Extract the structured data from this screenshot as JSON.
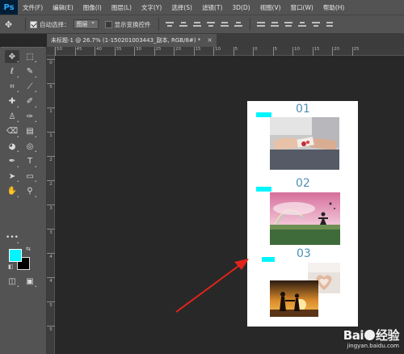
{
  "menubar": {
    "logo": "Ps",
    "items": [
      "文件(F)",
      "编辑(E)",
      "图像(I)",
      "图层(L)",
      "文字(Y)",
      "选择(S)",
      "滤镜(T)",
      "3D(D)",
      "视图(V)",
      "窗口(W)",
      "帮助(H)"
    ]
  },
  "options": {
    "auto_select_label": "自动选择：",
    "auto_select_checked": true,
    "auto_select_value": "图层",
    "show_transform_label": "显示变换控件",
    "show_transform_checked": false
  },
  "document_tab": {
    "title": "未标题-1 @ 26.7% (1-150201003443_副本, RGB/8#) *",
    "close": "×"
  },
  "ruler": {
    "h_labels": [
      "50",
      "45",
      "40",
      "35",
      "30",
      "25",
      "20",
      "15",
      "10",
      "5",
      "0",
      "5",
      "10",
      "15",
      "20",
      "25"
    ],
    "v_labels": [
      "0",
      "5",
      "1",
      "1",
      "2",
      "2",
      "3",
      "3",
      "4",
      "4",
      "5",
      "5"
    ]
  },
  "tools": [
    {
      "name": "move-tool",
      "glyph": "✥"
    },
    {
      "name": "marquee-tool",
      "glyph": "⬚"
    },
    {
      "name": "lasso-tool",
      "glyph": "ℓ"
    },
    {
      "name": "quick-select-tool",
      "glyph": "✎"
    },
    {
      "name": "crop-tool",
      "glyph": "⌗"
    },
    {
      "name": "eyedropper-tool",
      "glyph": "⟋"
    },
    {
      "name": "healing-tool",
      "glyph": "✚"
    },
    {
      "name": "brush-tool",
      "glyph": "✐"
    },
    {
      "name": "stamp-tool",
      "glyph": "♙"
    },
    {
      "name": "history-brush-tool",
      "glyph": "✑"
    },
    {
      "name": "eraser-tool",
      "glyph": "⌫"
    },
    {
      "name": "gradient-tool",
      "glyph": "▤"
    },
    {
      "name": "blur-tool",
      "glyph": "◕"
    },
    {
      "name": "dodge-tool",
      "glyph": "◎"
    },
    {
      "name": "pen-tool",
      "glyph": "✒"
    },
    {
      "name": "type-tool",
      "glyph": "T"
    },
    {
      "name": "path-select-tool",
      "glyph": "➤"
    },
    {
      "name": "shape-tool",
      "glyph": "▭"
    },
    {
      "name": "hand-tool",
      "glyph": "✋"
    },
    {
      "name": "zoom-tool",
      "glyph": "⚲"
    }
  ],
  "colors": {
    "foreground": "#00f6ff",
    "background": "#000000",
    "section_number": "#4f8fb4",
    "accent_bar": "#00f6ff"
  },
  "sections": [
    {
      "number": "01"
    },
    {
      "number": "02"
    },
    {
      "number": "03"
    }
  ],
  "watermark": {
    "logo_left": "Bai",
    "logo_right": "经验",
    "url": "jingyan.baidu.com"
  }
}
